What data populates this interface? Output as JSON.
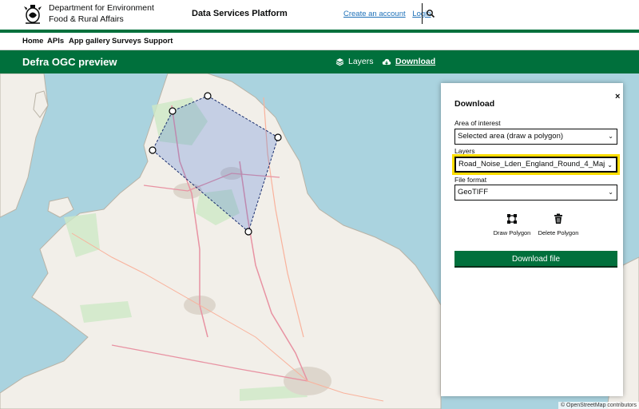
{
  "header": {
    "org_line1": "Department for Environment",
    "org_line2": "Food & Rural Affairs",
    "service_name": "Data Services Platform",
    "create_account": "Create an account",
    "login": "Login"
  },
  "nav": {
    "items": [
      "Home",
      "APIs",
      "App gallery",
      "Surveys",
      "Support"
    ]
  },
  "app_bar": {
    "title": "Defra OGC preview",
    "layers_label": "Layers",
    "download_label": "Download"
  },
  "map": {
    "attribution": "© OpenStreetMap contributors",
    "polygon_color": "#3f6fd6"
  },
  "download_panel": {
    "title": "Download",
    "close_label": "×",
    "area_label": "Area of interest",
    "area_value": "Selected area (draw a polygon)",
    "layers_label": "Layers",
    "layers_value": "Road_Noise_Lden_England_Round_4_Maj",
    "format_label": "File format",
    "format_value": "GeoTIFF",
    "draw_polygon": "Draw Polygon",
    "delete_polygon": "Delete Polygon",
    "download_button": "Download file"
  },
  "colors": {
    "brand_green": "#00703c",
    "link_blue": "#1d70b8",
    "focus_yellow": "#ffdd00"
  }
}
